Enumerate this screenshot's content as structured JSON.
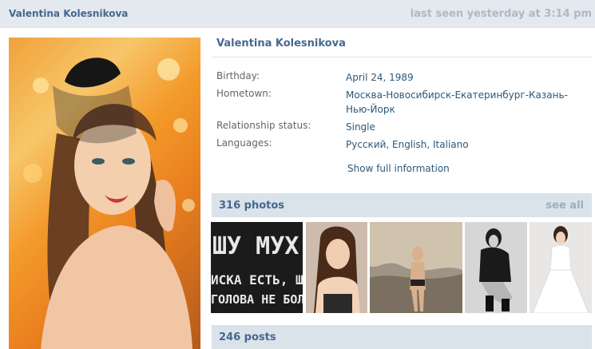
{
  "header": {
    "name": "Valentina Kolesnikova",
    "last_seen": "last seen yesterday at 3:14 pm"
  },
  "profile": {
    "name": "Valentina Kolesnikova",
    "fields": [
      {
        "label": "Birthday:",
        "value": "April 24, 1989"
      },
      {
        "label": "Hometown:",
        "value": "Москва-Новосибирск-Екатеринбург-Казань-Нью-Йорк"
      },
      {
        "label": "Relationship status:",
        "value": "Single"
      },
      {
        "label": "Languages:",
        "values": [
          "Русский",
          "English",
          "Italiano"
        ]
      }
    ],
    "show_full": "Show full information"
  },
  "photos": {
    "title": "316 photos",
    "see_all": "see all",
    "thumb_text": [
      "ШУ МУХ",
      "ИСКА ЕСТЬ, ШУБ",
      "ГОЛОВА НЕ БОЛ"
    ]
  },
  "posts": {
    "title": "246 posts"
  },
  "colors": {
    "link": "#2b587a",
    "header_text": "#45688e",
    "bar_bg": "#dae2ea"
  }
}
